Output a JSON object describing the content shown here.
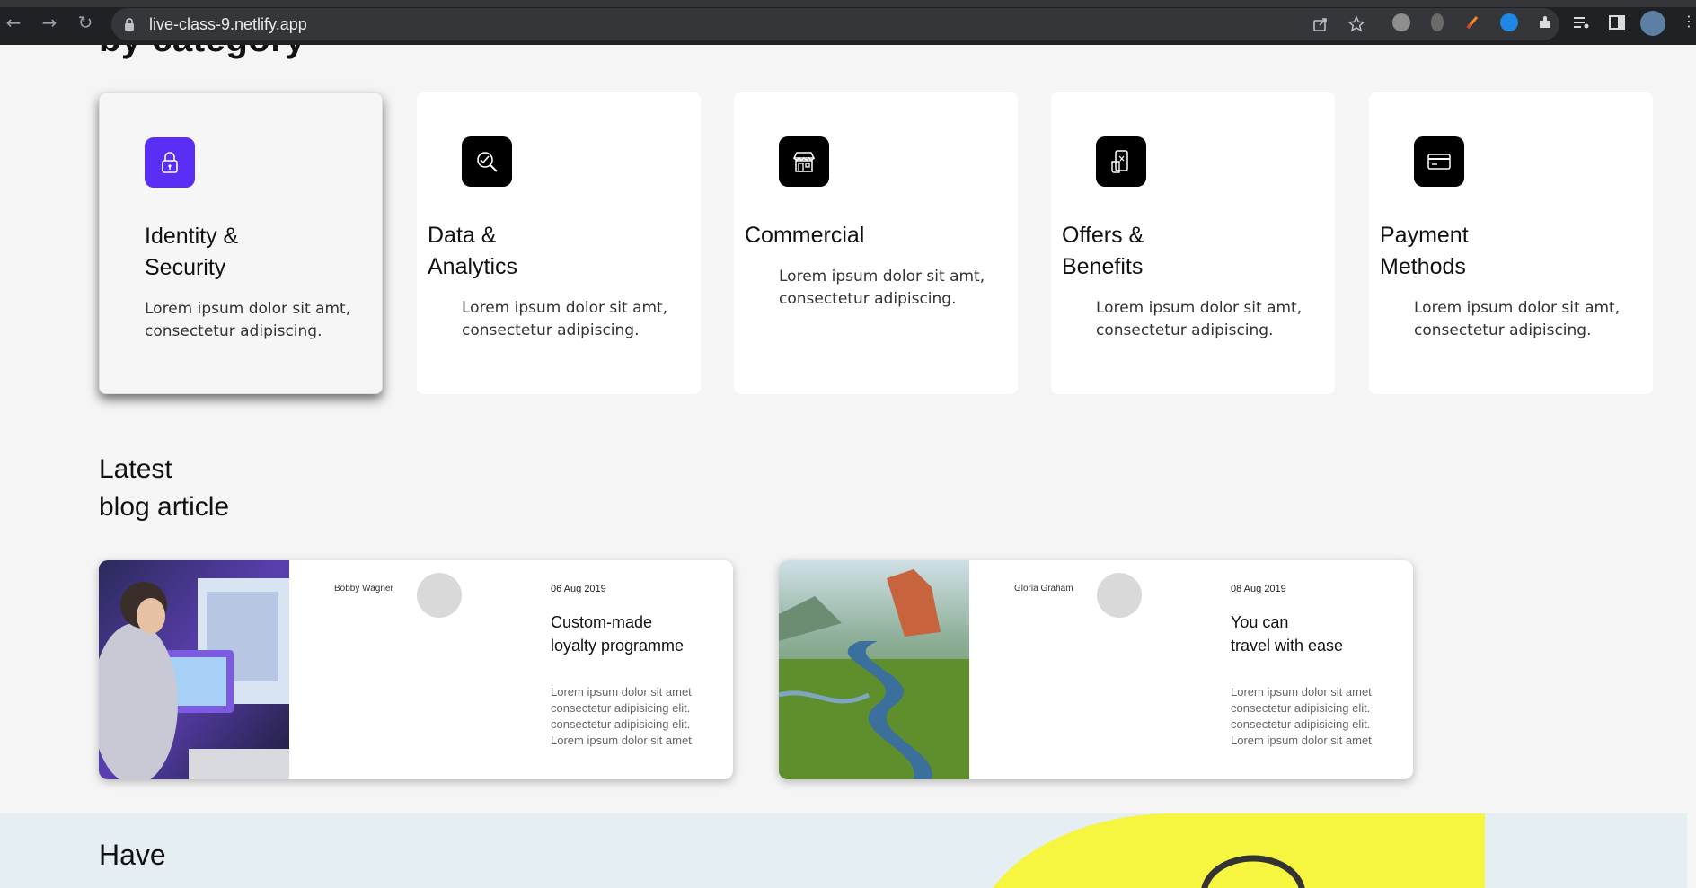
{
  "browser": {
    "url": "live-class-9.netlify.app",
    "back_icon": "arrow-left-icon",
    "forward_icon": "arrow-right-icon",
    "reload_icon": "reload-icon"
  },
  "categories": {
    "heading": "by category",
    "items": [
      {
        "title_line1": "Identity &",
        "title_line2": "Security",
        "desc_line1": "Lorem ipsum dolor sit amt,",
        "desc_line2": "consectetur adipiscing.",
        "icon": "lock-icon",
        "accent": "#5b2ef5"
      },
      {
        "title_line1": "Data &",
        "title_line2": "Analytics",
        "desc_line1": "Lorem ipsum dolor sit amt,",
        "desc_line2": "consectetur adipiscing.",
        "icon": "analytics-search-icon",
        "accent": "#000000"
      },
      {
        "title_line1": "Commercial",
        "title_line2": "",
        "desc_line1": "Lorem ipsum dolor sit amt,",
        "desc_line2": "consectetur adipiscing.",
        "icon": "store-icon",
        "accent": "#000000"
      },
      {
        "title_line1": "Offers &",
        "title_line2": "Benefits",
        "desc_line1": "Lorem ipsum dolor sit amt,",
        "desc_line2": "consectetur adipiscing.",
        "icon": "mobile-offer-icon",
        "accent": "#000000"
      },
      {
        "title_line1": "Payment",
        "title_line2": "Methods",
        "desc_line1": "Lorem ipsum dolor sit amt,",
        "desc_line2": "consectetur adipiscing.",
        "icon": "credit-card-icon",
        "accent": "#000000"
      }
    ]
  },
  "blog": {
    "heading_line1": "Latest",
    "heading_line2": "blog article",
    "articles": [
      {
        "author": "Bobby Wagner",
        "date": "06 Aug 2019",
        "title_line1": "Custom-made",
        "title_line2": "loyalty programme",
        "text": [
          "Lorem ipsum dolor sit amet",
          "consectetur adipisicing elit.",
          "consectetur adipisicing elit.",
          "Lorem ipsum dolor sit amet"
        ]
      },
      {
        "author": "Gloria Graham",
        "date": "08 Aug 2019",
        "title_line1": "You can",
        "title_line2": "travel with ease",
        "text": [
          "Lorem ipsum dolor sit amet",
          "consectetur adipisicing elit.",
          "consectetur adipisicing elit.",
          "Lorem ipsum dolor sit amet"
        ]
      }
    ]
  },
  "contact": {
    "heading": "Have"
  }
}
